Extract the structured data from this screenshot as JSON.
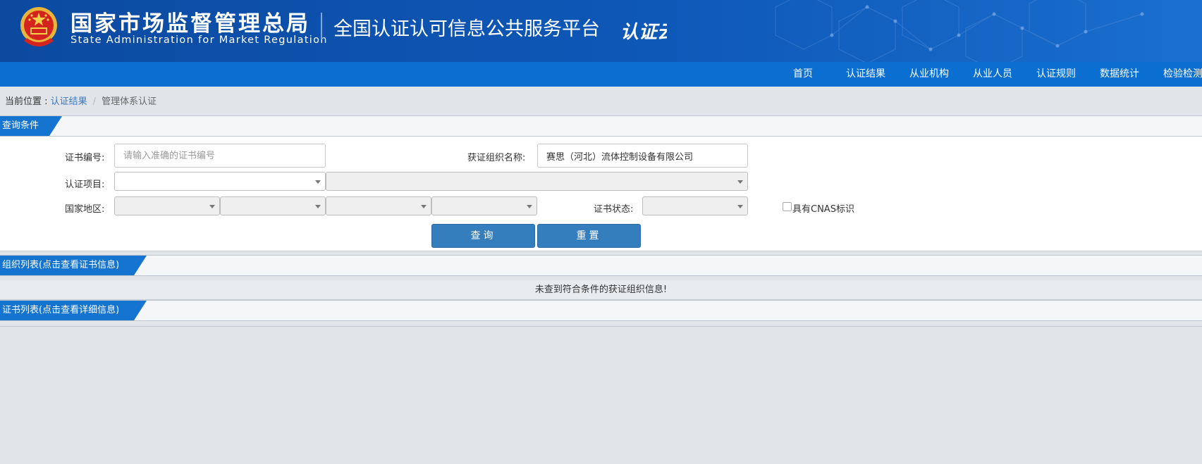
{
  "header": {
    "org_name_cn": "国家市场监督管理总局",
    "org_name_en": "State Administration  for  Market Regulation",
    "platform_title": "全国认证认可信息公共服务平台",
    "logo_text": "认证云"
  },
  "nav": {
    "items": [
      "首页",
      "认证结果",
      "从业机构",
      "从业人员",
      "认证规则",
      "数据统计",
      "检验检测"
    ]
  },
  "breadcrumb": {
    "label": "当前位置 : ",
    "link": "认证结果",
    "separator": "/",
    "current": "管理体系认证"
  },
  "query": {
    "section_title": "查询条件",
    "cert_no_label": "证书编号:",
    "cert_no_placeholder": "请输入准确的证书编号",
    "cert_no_value": "",
    "org_name_label": "获证组织名称:",
    "org_name_value": "赛思（河北）流体控制设备有限公司",
    "project_label": "认证项目:",
    "region_label": "国家地区:",
    "status_label": "证书状态:",
    "cnas_label": "具有CNAS标识",
    "cnas_checked": false,
    "search_button": "查询",
    "reset_button": "重置"
  },
  "org_list": {
    "section_title": "组织列表(点击查看证书信息)",
    "empty_message": "未查到符合条件的获证组织信息!"
  },
  "cert_list": {
    "section_title": "证书列表(点击查看详细信息)"
  },
  "colors": {
    "header_bg": "#0e58b8",
    "nav_bg": "#0a6fd1",
    "section_tag": "#1474d0",
    "button": "#357ebd",
    "link": "#3a77c1"
  }
}
